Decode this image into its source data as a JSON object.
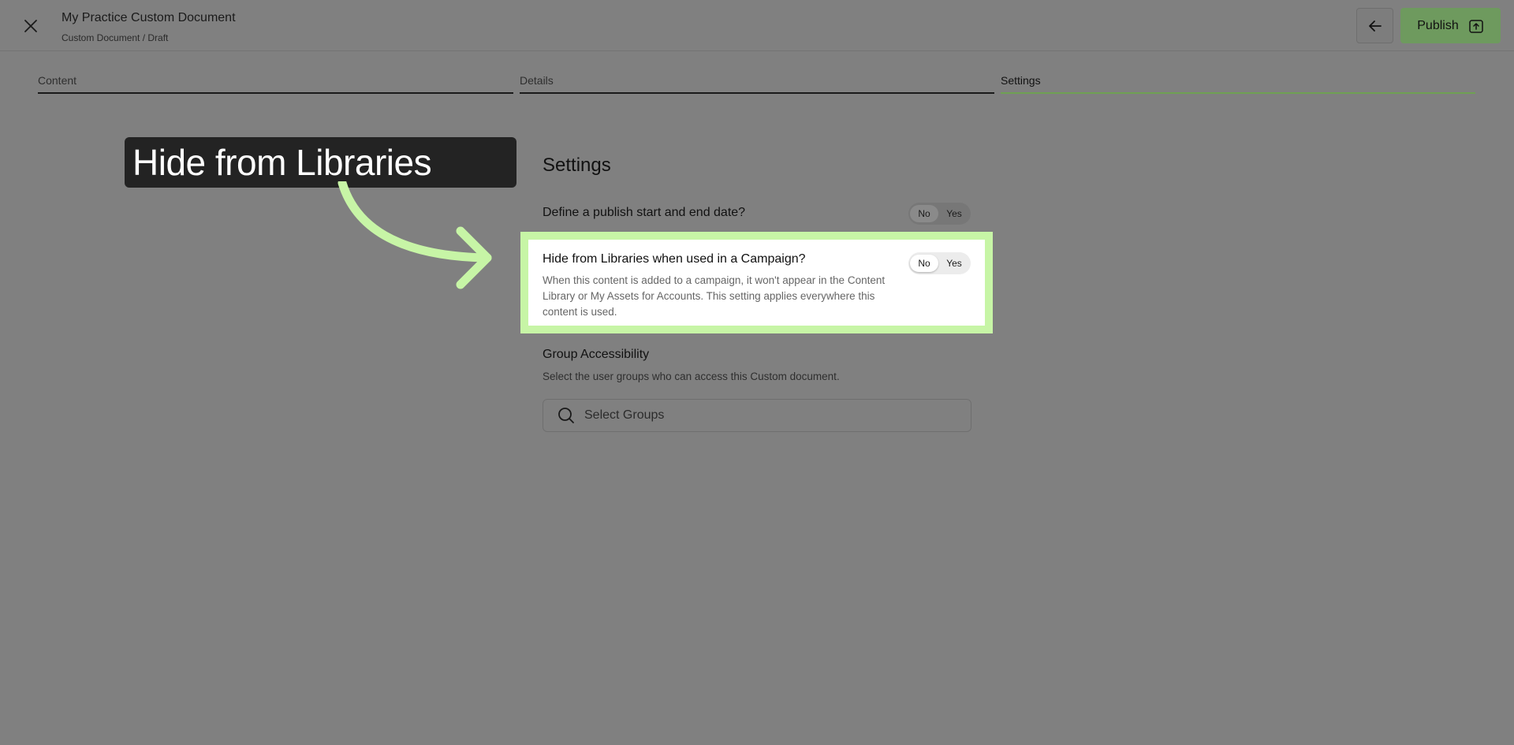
{
  "header": {
    "title": "My Practice Custom Document",
    "breadcrumb": "Custom Document / Draft",
    "publish_label": "Publish"
  },
  "tabs": [
    {
      "label": "Content"
    },
    {
      "label": "Details"
    },
    {
      "label": "Settings",
      "active": true
    }
  ],
  "callout": {
    "text": "Hide from Libraries",
    "color": "#c7f5a6"
  },
  "settings": {
    "title": "Settings",
    "publish_dates": {
      "label": "Define a publish start and end date?",
      "options": [
        "No",
        "Yes"
      ],
      "selected": "No"
    },
    "hide_from_libraries": {
      "label": "Hide from Libraries when used in a Campaign?",
      "description": "When this content is added to a campaign, it won't appear in the Content Library or My Assets for Accounts. This setting applies everywhere this content is used.",
      "options": [
        "No",
        "Yes"
      ],
      "selected": "No"
    },
    "group_accessibility": {
      "label": "Group Accessibility",
      "description": "Select the user groups who can access this Custom document.",
      "search_placeholder": "Select Groups"
    }
  },
  "icons": {
    "close": "close-icon",
    "back": "arrow-left-icon",
    "publish": "publish-icon",
    "search": "search-icon"
  },
  "colors": {
    "accent_green": "#6fa153",
    "highlight": "#c7f5a6",
    "overlay": "#808080"
  }
}
